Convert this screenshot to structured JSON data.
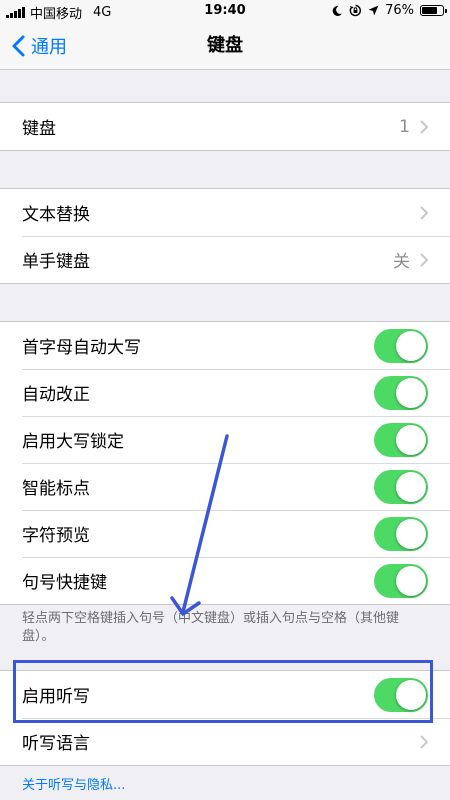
{
  "status_bar": {
    "carrier": "中国移动",
    "network": "4G",
    "time": "19:40",
    "battery_text": "76%",
    "battery_level": 0.76,
    "icons": [
      "moon-icon",
      "rotation-lock-icon",
      "location-arrow-icon"
    ]
  },
  "nav": {
    "back_label": "通用",
    "title": "键盘"
  },
  "groups": {
    "keyboards": {
      "label": "键盘",
      "value": "1"
    },
    "text": {
      "replacement_label": "文本替换",
      "one_handed_label": "单手键盘",
      "one_handed_value": "关"
    },
    "toggles": {
      "auto_capitalization": {
        "label": "首字母自动大写",
        "on": true
      },
      "auto_correction": {
        "label": "自动改正",
        "on": true
      },
      "caps_lock": {
        "label": "启用大写锁定",
        "on": true
      },
      "smart_punctuation": {
        "label": "智能标点",
        "on": true
      },
      "character_preview": {
        "label": "字符预览",
        "on": true
      },
      "period_shortcut": {
        "label": "句号快捷键",
        "on": true
      }
    },
    "footnote": "轻点两下空格键插入句号（中文键盘）或插入句点与空格（其他键盘）。",
    "dictation": {
      "enable_label": "启用听写",
      "enable_on": true,
      "language_label": "听写语言"
    },
    "privacy_link": "关于听写与隐私..."
  },
  "colors": {
    "accent": "#007aff",
    "switch_on": "#4cd964",
    "annotation": "#3b56d6",
    "background": "#efeff4"
  }
}
